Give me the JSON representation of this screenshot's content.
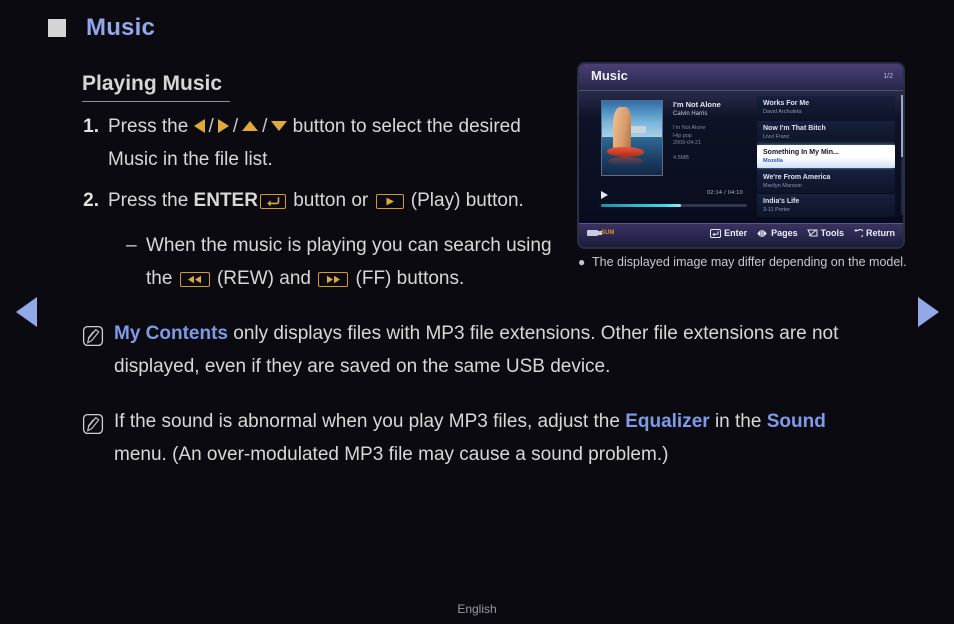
{
  "header": {
    "title": "Music",
    "bullet_icon": "square-bullet-icon"
  },
  "section": {
    "title": "Playing Music"
  },
  "steps": [
    {
      "num": "1.",
      "pre": "Press the ",
      "post": " button to select the desired Music in the file list.",
      "icons": [
        "arrow-left-icon",
        "arrow-right-icon",
        "arrow-up-icon",
        "arrow-down-icon"
      ],
      "separator": "/"
    },
    {
      "num": "2.",
      "pre": "Press the ",
      "enter_label": "ENTER",
      "mid": " button or ",
      "post": " (Play) button.",
      "icons": [
        "enter-key-icon",
        "play-key-icon"
      ]
    }
  ],
  "dash_item": {
    "dash": "–",
    "pre": "When the music is playing you can search using the ",
    "rew_label": "(REW)",
    "mid": " and ",
    "ff_label": "(FF)",
    "post": " buttons.",
    "icons": [
      "rewind-key-icon",
      "fast-forward-key-icon"
    ]
  },
  "notes": [
    {
      "icon": "note-pencil-icon",
      "highlight1": "My Contents",
      "text1": " only displays files with MP3 file extensions. Other file extensions are not displayed, even if they are saved on the same USB device."
    },
    {
      "icon": "note-pencil-icon",
      "text0": "If the sound is abnormal when you play MP3 files, adjust the ",
      "highlight1": "Equalizer",
      "text1": " in the ",
      "highlight2": "Sound",
      "text2": " menu. (An over-modulated MP3 file may cause a sound problem.)"
    }
  ],
  "tv": {
    "title": "Music",
    "page_indicator": "1/2",
    "now_playing": {
      "title": "I'm Not Alone",
      "artist": "Calvin Harris",
      "album": "I'm Not Alone",
      "genre": "Hip pop",
      "date": "2009-04-21",
      "size": "4.5MB",
      "time": "02:14 / 04:10",
      "progress_percent": 55,
      "play_icon": "play-icon",
      "album_art": "album-art-thumbnail"
    },
    "tracks": [
      {
        "title": "Works For Me",
        "artist": "David Archuleta",
        "selected": false
      },
      {
        "title": "Now I'm That Bitch",
        "artist": "Livvi Franc",
        "selected": false
      },
      {
        "title": "Something In My Min...",
        "artist": "Mozella",
        "selected": true
      },
      {
        "title": "We're From America",
        "artist": "Marilyn Manson",
        "selected": false
      },
      {
        "title": "India's Life",
        "artist": "3-11 Porter",
        "selected": false
      }
    ],
    "source": {
      "icon": "usb-icon",
      "label": "SUM"
    },
    "hints": [
      {
        "icon": "enter-hint-icon",
        "label": "Enter"
      },
      {
        "icon": "pages-hint-icon",
        "label": "Pages"
      },
      {
        "icon": "tools-hint-icon",
        "label": "Tools"
      },
      {
        "icon": "return-hint-icon",
        "label": "Return"
      }
    ]
  },
  "caption": {
    "bullet": "●",
    "text": "The displayed image may differ depending on the model."
  },
  "nav": {
    "prev_icon": "prev-page-arrow",
    "next_icon": "next-page-arrow"
  },
  "footer": {
    "language": "English"
  },
  "colors": {
    "accent_blue": "#93a8e8",
    "key_gold": "#e0a93a",
    "background": "#0a0a10",
    "body_text": "#d8d8d8",
    "progress": "#49d7e8"
  }
}
